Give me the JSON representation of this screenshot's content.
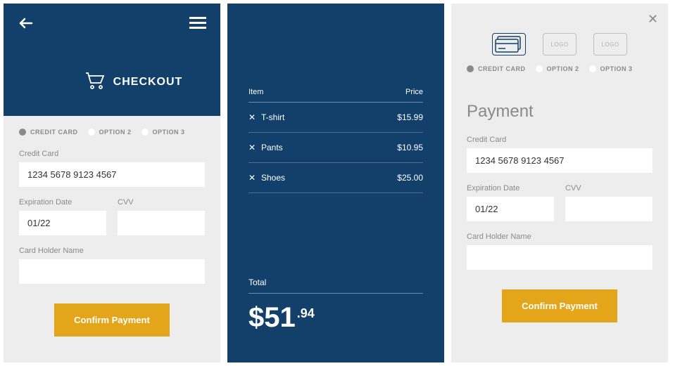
{
  "panel1": {
    "title": "CHECKOUT",
    "options": [
      {
        "label": "CREDIT CARD",
        "selected": true
      },
      {
        "label": "OPTION 2",
        "selected": false
      },
      {
        "label": "OPTION 3",
        "selected": false
      }
    ],
    "creditCardLabel": "Credit Card",
    "creditCardValue": "1234 5678 9123 4567",
    "expLabel": "Expiration Date",
    "expValue": "01/22",
    "cvvLabel": "CVV",
    "cvvValue": "",
    "holderLabel": "Card Holder Name",
    "holderValue": "",
    "confirm": "Confirm Payment"
  },
  "panel2": {
    "itemHeader": "Item",
    "priceHeader": "Price",
    "rows": [
      {
        "item": "T-shirt",
        "price": "$15.99"
      },
      {
        "item": "Pants",
        "price": "$10.95"
      },
      {
        "item": "Shoes",
        "price": "$25.00"
      }
    ],
    "totalLabel": "Total",
    "totalWhole": "$51",
    "totalCents": ".94"
  },
  "panel3": {
    "logoText": "LOGO",
    "options": [
      {
        "label": "CREDIT CARD",
        "selected": true
      },
      {
        "label": "OPTION 2",
        "selected": false
      },
      {
        "label": "OPTION 3",
        "selected": false
      }
    ],
    "paymentTitle": "Payment",
    "creditCardLabel": "Credit Card",
    "creditCardValue": "1234 5678 9123 4567",
    "expLabel": "Expiration Date",
    "expValue": "01/22",
    "cvvLabel": "CVV",
    "cvvValue": "",
    "holderLabel": "Card Holder Name",
    "holderValue": "",
    "confirm": "Confirm Payment"
  }
}
